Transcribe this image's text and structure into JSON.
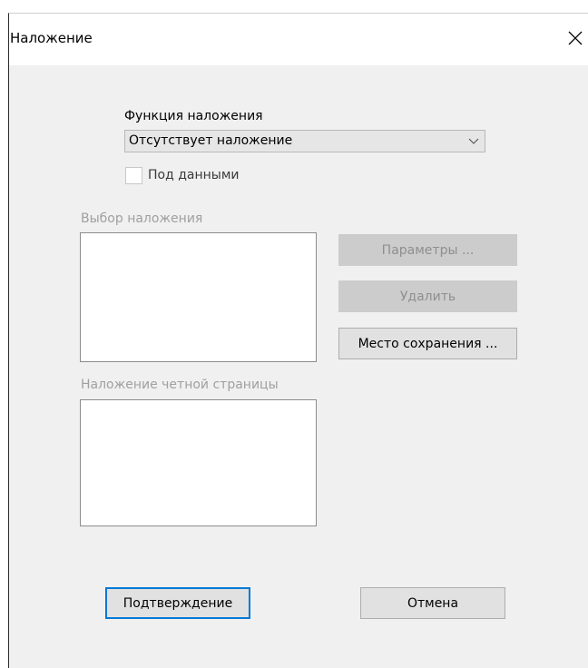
{
  "dialog": {
    "title": "Наложение",
    "close_icon": "close-icon"
  },
  "overlay_function": {
    "label": "Функция наложения",
    "selected": "Отсутствует наложение",
    "chevron_icon": "chevron-down-icon"
  },
  "under_data": {
    "label": "Под данными",
    "checked": false,
    "enabled": false
  },
  "overlay_select": {
    "label": "Выбор наложения",
    "items": []
  },
  "buttons": {
    "parameters": "Параметры ...",
    "delete": "Удалить",
    "save_location": "Место сохранения ...",
    "confirm": "Подтверждение",
    "cancel": "Отмена"
  },
  "even_page": {
    "label": "Наложение четной страницы",
    "items": []
  },
  "colors": {
    "dialog_bg": "#f0f0f0",
    "disabled_text": "#a0a0a0",
    "default_button_border": "#0078d7"
  }
}
